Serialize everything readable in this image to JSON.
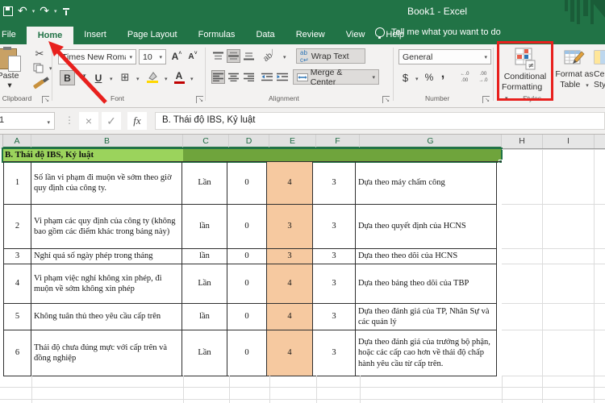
{
  "titlebar": {
    "title": "Book1  -  Excel"
  },
  "tabs": [
    {
      "label": "File",
      "active": false
    },
    {
      "label": "Home",
      "active": true
    },
    {
      "label": "Insert",
      "active": false
    },
    {
      "label": "Page Layout",
      "active": false
    },
    {
      "label": "Formulas",
      "active": false
    },
    {
      "label": "Data",
      "active": false
    },
    {
      "label": "Review",
      "active": false
    },
    {
      "label": "View",
      "active": false
    },
    {
      "label": "Help",
      "active": false
    }
  ],
  "tell_me": "Tell me what you want to do",
  "ribbon": {
    "clipboard": {
      "label": "Clipboard",
      "paste": "Paste"
    },
    "font": {
      "label": "Font",
      "font_name": "Times New Romar",
      "font_size": "10",
      "bold": "B",
      "italic": "I",
      "underline": "U",
      "grow": "A",
      "shrink": "A",
      "font_color": "A"
    },
    "alignment": {
      "label": "Alignment",
      "wrap_text": "Wrap Text",
      "merge_center": "Merge & Center",
      "orientation": "ab"
    },
    "number": {
      "label": "Number",
      "format": "General",
      "currency": "$",
      "percent": "%",
      "comma": ",",
      "inc_dec_top": "←.0",
      "inc_dec_bot": ".00",
      "dec_dec_top": ".00",
      "dec_dec_bot": "→.0"
    },
    "styles": {
      "label": "Styles",
      "conditional_l1": "Conditional",
      "conditional_l2": "Formatting",
      "conditional_badge": "≠",
      "format_table_l1": "Format as",
      "format_table_l2": "Table",
      "cell_styles_l1": "Cell",
      "cell_styles_l2": "Styles"
    }
  },
  "formula_bar": {
    "name_box": "1",
    "fx": "fx",
    "value": "B. Thái độ IBS, Kỷ luật"
  },
  "sheet": {
    "columns": [
      "A",
      "B",
      "C",
      "D",
      "E",
      "F",
      "G",
      "H",
      "I"
    ],
    "selected_columns": [
      "A",
      "B",
      "C",
      "D",
      "E",
      "F",
      "G"
    ],
    "section_header": "B. Thái độ IBS, Kỷ luật",
    "table_rows": [
      {
        "no": "1",
        "criteria": "Số lần vi phạm đi muộn về sớm theo giờ quy định của công ty.",
        "unit": "Lần",
        "min": "0",
        "score": "4",
        "max": "3",
        "basis": "Dựa theo máy chấm công"
      },
      {
        "no": "2",
        "criteria": "Vi phạm các quy định của công ty (không bao gồm các điểm khác trong bảng này)",
        "unit": "lần",
        "min": "0",
        "score": "3",
        "max": "3",
        "basis": "Dựa theo quyết định của HCNS"
      },
      {
        "no": "3",
        "criteria": "Nghỉ quá số ngày phép trong tháng",
        "unit": "lần",
        "min": "0",
        "score": "3",
        "max": "3",
        "basis": "Dựa theo theo dõi của HCNS"
      },
      {
        "no": "4",
        "criteria": "Vi phạm việc nghỉ không xin phép, đi muộn về sớm không xin phép",
        "unit": "Lần",
        "min": "0",
        "score": "4",
        "max": "3",
        "basis": "Dựa theo bảng theo dõi của TBP"
      },
      {
        "no": "5",
        "criteria": "Không tuân thủ theo yêu cầu cấp trên",
        "unit": "lần",
        "min": "0",
        "score": "4",
        "max": "3",
        "basis": "Dựa theo đánh giá của TP, Nhân Sự và các quản lý"
      },
      {
        "no": "6",
        "criteria": "Thái độ chưa đúng mực với cấp trên và đồng nghiệp",
        "unit": "Lần",
        "min": "0",
        "score": "4",
        "max": "3",
        "basis": "Dựa theo đánh giá của trưởng bộ phận, hoặc các cấp cao hơn về thái độ chấp hành yêu cầu từ cấp trên."
      }
    ]
  },
  "colors": {
    "excel_green": "#217346",
    "section_light_green": "#9bd35c",
    "section_dark_green": "#6fa43c",
    "cell_orange": "#f6c9a0",
    "annotation_red": "#e8201d"
  }
}
